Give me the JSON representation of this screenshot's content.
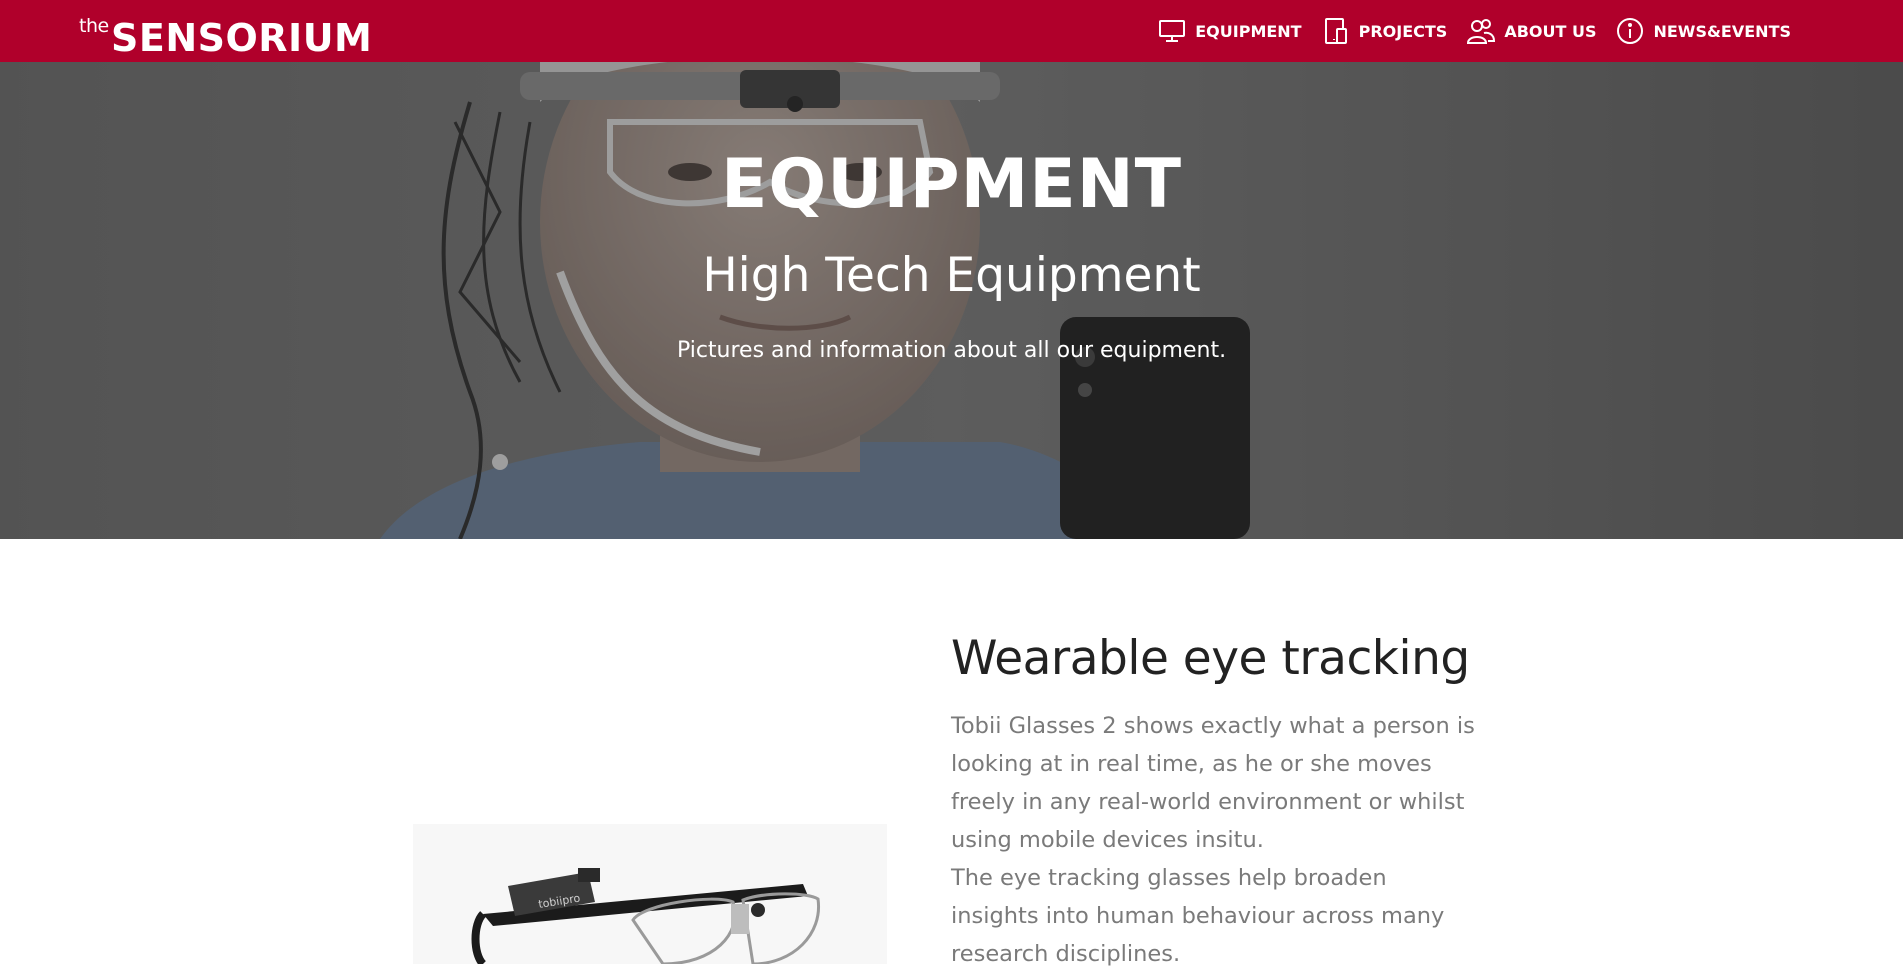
{
  "brand": {
    "prefix": "the",
    "name": "SENSORIUM",
    "accent_color": "#b0002b"
  },
  "nav": {
    "items": [
      {
        "label": "EQUIPMENT",
        "icon": "monitor-icon"
      },
      {
        "label": "PROJECTS",
        "icon": "devices-icon"
      },
      {
        "label": "ABOUT US",
        "icon": "users-icon"
      },
      {
        "label": "NEWS&EVENTS",
        "icon": "info-icon"
      }
    ]
  },
  "hero": {
    "title": "EQUIPMENT",
    "subtitle": "High Tech Equipment",
    "description": "Pictures and information about all our equipment."
  },
  "section": {
    "title": "Wearable eye tracking",
    "paragraphs": [
      "Tobii Glasses 2 shows exactly what a person is looking at in real time, as he or she moves freely in any real-world environment or whilst using mobile devices insitu.",
      "The eye tracking glasses help broaden insights into human behaviour across many research disciplines."
    ],
    "product_logo": "tobiipro"
  }
}
